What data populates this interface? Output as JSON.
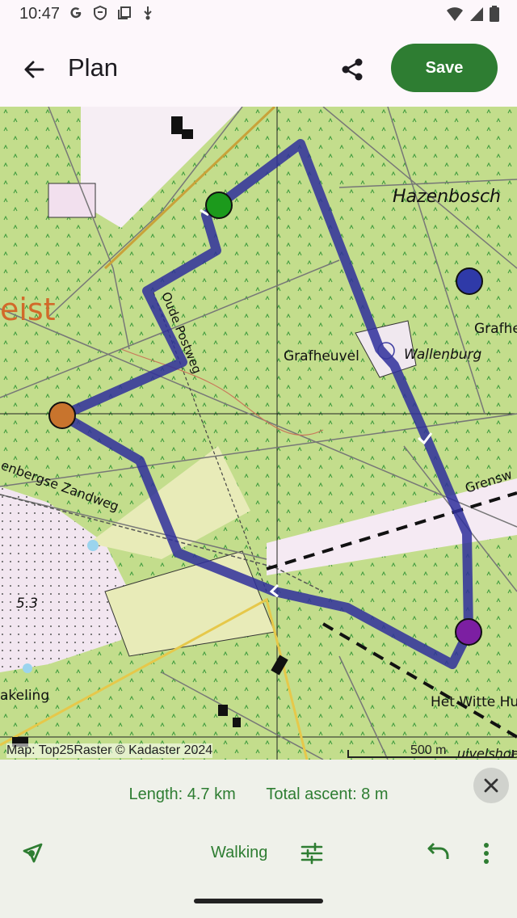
{
  "status_bar": {
    "time": "10:47",
    "left_icons": [
      "google-icon",
      "shield-icon",
      "copy-icon",
      "download-icon"
    ],
    "right_icons": [
      "wifi-icon",
      "signal-icon",
      "battery-icon"
    ]
  },
  "app_bar": {
    "title": "Plan",
    "back_icon": "arrow-back-icon",
    "share_icon": "share-icon",
    "save_label": "Save"
  },
  "map": {
    "labels": {
      "hazenbosch": "Hazenbosch",
      "grafheuvel": "Grafheuvel",
      "wallenburg": "Wallenburg",
      "grafhe": "Grafhe",
      "oude_postweg": "Oude Postweg",
      "zandweg": "enbergse Zandweg",
      "grensw": "Grensw",
      "zeist": "eist",
      "elevation": "5.3",
      "kaeling": "akeling",
      "witte_huis": "Het Witte Hu",
      "uivelshoek": "uivelshoek"
    },
    "attribution": "Map: Top25Raster © Kadaster 2024",
    "scale": "500 m"
  },
  "route": {
    "color": "#2f2f9b",
    "waypoint_colors": {
      "start": "#1c9a1c",
      "via_1": "#c8742d",
      "via_2": "#7c1fa2",
      "unrouted": "#2f3aa8"
    }
  },
  "bottom_sheet": {
    "length": "Length: 4.7 km",
    "ascent": "Total ascent: 8 m",
    "mode": "Walking",
    "icons": [
      "route-icon",
      "tune-icon",
      "undo-icon",
      "more-vert-icon",
      "close-icon"
    ]
  },
  "colors": {
    "primary": "#2e7d32",
    "surface": "#fdf7fb",
    "sheet": "#eff1ea"
  }
}
